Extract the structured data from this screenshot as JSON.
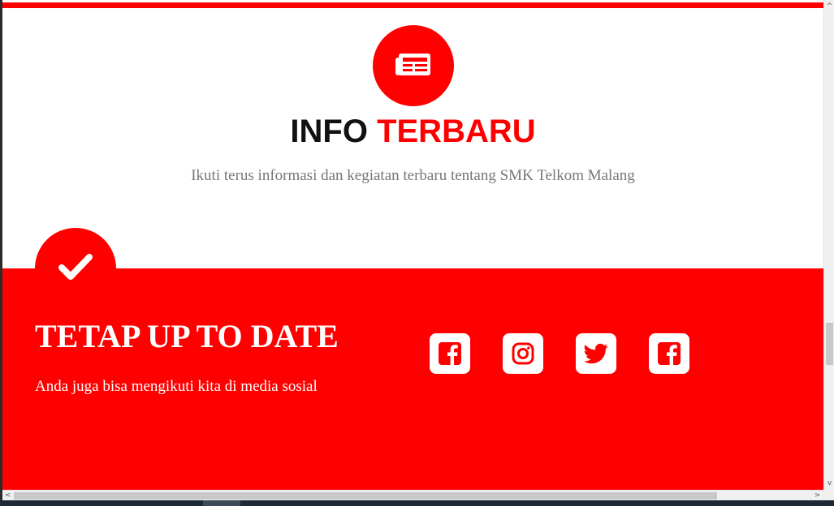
{
  "colors": {
    "accent": "#ff0000",
    "heading_dark": "#111111",
    "subtitle_gray": "#777777"
  },
  "info_section": {
    "icon": "newspaper-icon",
    "title_part1": "INFO",
    "title_part2": "TERBARU",
    "subtitle": "Ikuti terus informasi dan kegiatan terbaru tentang SMK Telkom Malang"
  },
  "update_section": {
    "icon": "check-icon",
    "title": "TETAP UP TO DATE",
    "subtitle": "Anda juga bisa mengikuti kita di media sosial",
    "social": [
      {
        "icon": "facebook-icon"
      },
      {
        "icon": "instagram-icon"
      },
      {
        "icon": "twitter-icon"
      },
      {
        "icon": "facebook-icon"
      }
    ]
  },
  "scrollbars": {
    "up": "^",
    "down": "v",
    "left": "<",
    "right": ">"
  }
}
